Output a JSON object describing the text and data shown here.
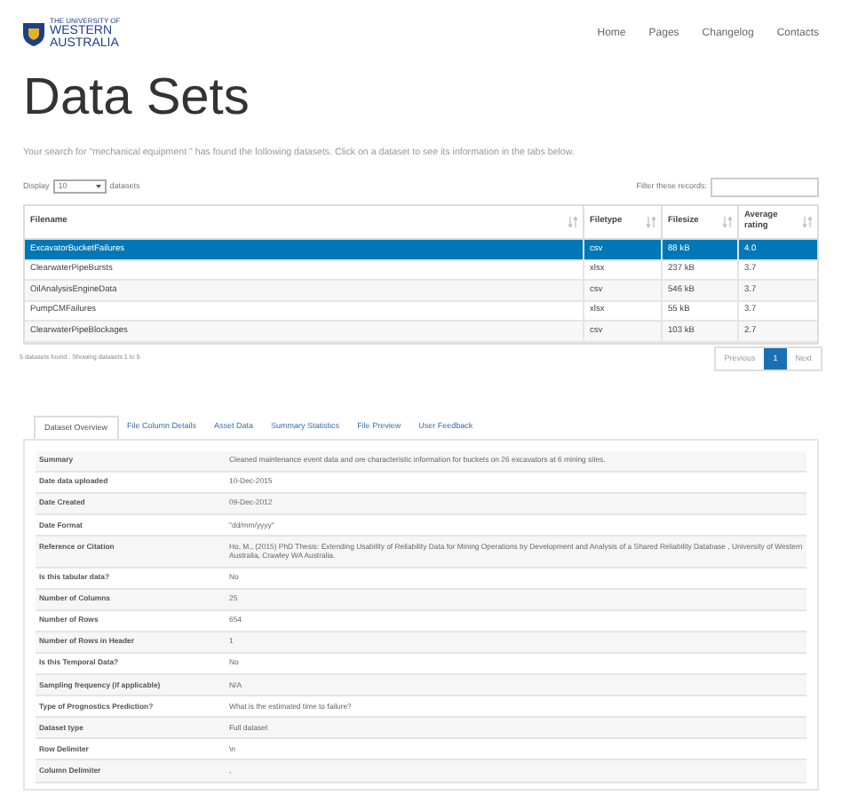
{
  "logo": {
    "line_1": "THE UNIVERSITY OF",
    "line_2": "WESTERN",
    "line_3": "AUSTRALIA"
  },
  "nav": [
    "Home",
    "Pages",
    "Changelog",
    "Contacts"
  ],
  "title": "Data Sets",
  "intro": "Your search for \"mechanical equipment \" has found the following datasets. Click on a dataset to see its information in the tabs below.",
  "display": {
    "before": "Display",
    "value": "10",
    "after": "datasets"
  },
  "filter": {
    "label": "Filter these records:"
  },
  "table": {
    "columns": [
      "Filename",
      "Filetype",
      "Filesize",
      "Average rating"
    ],
    "rows": [
      {
        "selected": true,
        "cells": [
          "ExcavatorBucketFailures",
          "csv",
          "88 kB",
          "4.0"
        ]
      },
      {
        "selected": false,
        "cells": [
          "ClearwaterPipeBursts",
          "xlsx",
          "237 kB",
          "3.7"
        ]
      },
      {
        "selected": false,
        "cells": [
          "OilAnalysisEngineData",
          "csv",
          "546 kB",
          "3.7"
        ]
      },
      {
        "selected": false,
        "cells": [
          "PumpCMFailures",
          "xlsx",
          "55 kB",
          "3.7"
        ]
      },
      {
        "selected": false,
        "cells": [
          "ClearwaterPipeBlockages",
          "csv",
          "103 kB",
          "2.7"
        ]
      }
    ]
  },
  "table_info": "5 datasets found . Showing datasets 1 to 5",
  "pagination": [
    {
      "label": "Previous",
      "selected": false
    },
    {
      "label": "1",
      "selected": true
    },
    {
      "label": "Next",
      "selected": false
    }
  ],
  "tabs": [
    {
      "label": "Dataset Overview",
      "selected": true
    },
    {
      "label": "File Column Details",
      "selected": false
    },
    {
      "label": "Asset Data",
      "selected": false
    },
    {
      "label": "Summary Statistics",
      "selected": false
    },
    {
      "label": "File Preview",
      "selected": false
    },
    {
      "label": "User Feedback",
      "selected": false
    }
  ],
  "details": [
    [
      "Summary",
      "Cleaned maintenance event data and ore characteristic information for buckets on 26 excavators at 6 mining sites."
    ],
    [
      "Date data uploaded",
      "10-Dec-2015"
    ],
    [
      "Date Created",
      "09-Dec-2012"
    ],
    [
      "Date Format",
      "\"dd/mm/yyyy\""
    ],
    [
      "Reference or Citation",
      "Ho, M., (2015) PhD Thesis: Extending Usability of Reliability Data for Mining Operations by Development and Analysis of a Shared Reliability Database , University of Western Australia, Crawley WA Australia."
    ],
    [
      "Is this tabular data?",
      "No"
    ],
    [
      "Number of Columns",
      "25"
    ],
    [
      "Number of Rows",
      "654"
    ],
    [
      "Number of Rows in Header",
      "1"
    ],
    [
      "Is this Temporal Data?",
      "No"
    ],
    [
      "Sampling frequency (if applicable)",
      "N/A"
    ],
    [
      "Type of Prognostics Prediction?",
      "What is the estimated time to failure?"
    ],
    [
      "Dataset type",
      "Full dataset"
    ],
    [
      "Row Delimiter",
      "\\n"
    ],
    [
      "Column Delimiter",
      ","
    ]
  ]
}
